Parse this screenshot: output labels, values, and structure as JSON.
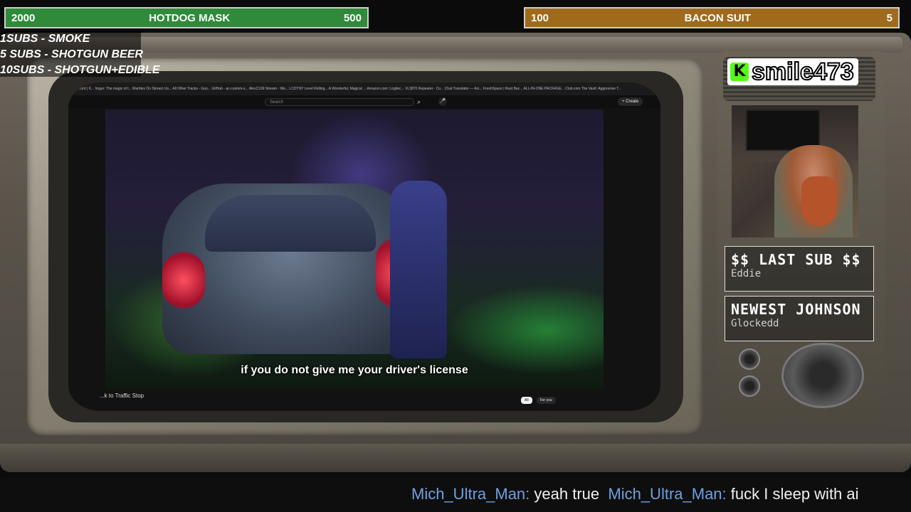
{
  "goals": {
    "left": {
      "current": "2000",
      "label": "HOTDOG MASK",
      "target": "500",
      "color": "#2f8a3a"
    },
    "right": {
      "current": "100",
      "label": "BACON SUIT",
      "target": "5",
      "color": "#a06a1c"
    }
  },
  "sub_rules": [
    "1SUBS   - SMOKE",
    "5 SUBS  - SHOTGUN BEER",
    "10SUBS - SHOTGUN+EDIBLE"
  ],
  "browser": {
    "tabs": "ocord | K... Imgur: The magic of t... Marbles On Stream Us... All Other Tracks - Goo... GitHub - ac-custom-s... AlexC199 Stream - We... LCDTNY Level Rolling... A Wonderful, Magical ... Amazon.com: Logitec... VL3870 Repeater - Co... Chat Translator — Aci... FreshSpace | Rust Bac... ALL-IN-ONE PACKAGE... Club.com The Vault: Aggressive T...",
    "search_placeholder": "Search",
    "create_label": "Create",
    "video_caption": "if you do not give me your driver's license",
    "video_title": "...k to Traffic Stop",
    "chips": [
      "All",
      "For you"
    ]
  },
  "channel": {
    "name": "smile473",
    "icon": "kick-logo-icon"
  },
  "last_sub": {
    "header": "$$ LAST SUB $$",
    "value": "Eddie"
  },
  "newest": {
    "header": "NEWEST JOHNSON",
    "value": "Glockedd"
  },
  "chat": [
    {
      "user": "Mich_Ultra_Man:",
      "message": "yeah true"
    },
    {
      "user": "Mich_Ultra_Man:",
      "message": "fuck I sleep with ai"
    }
  ]
}
